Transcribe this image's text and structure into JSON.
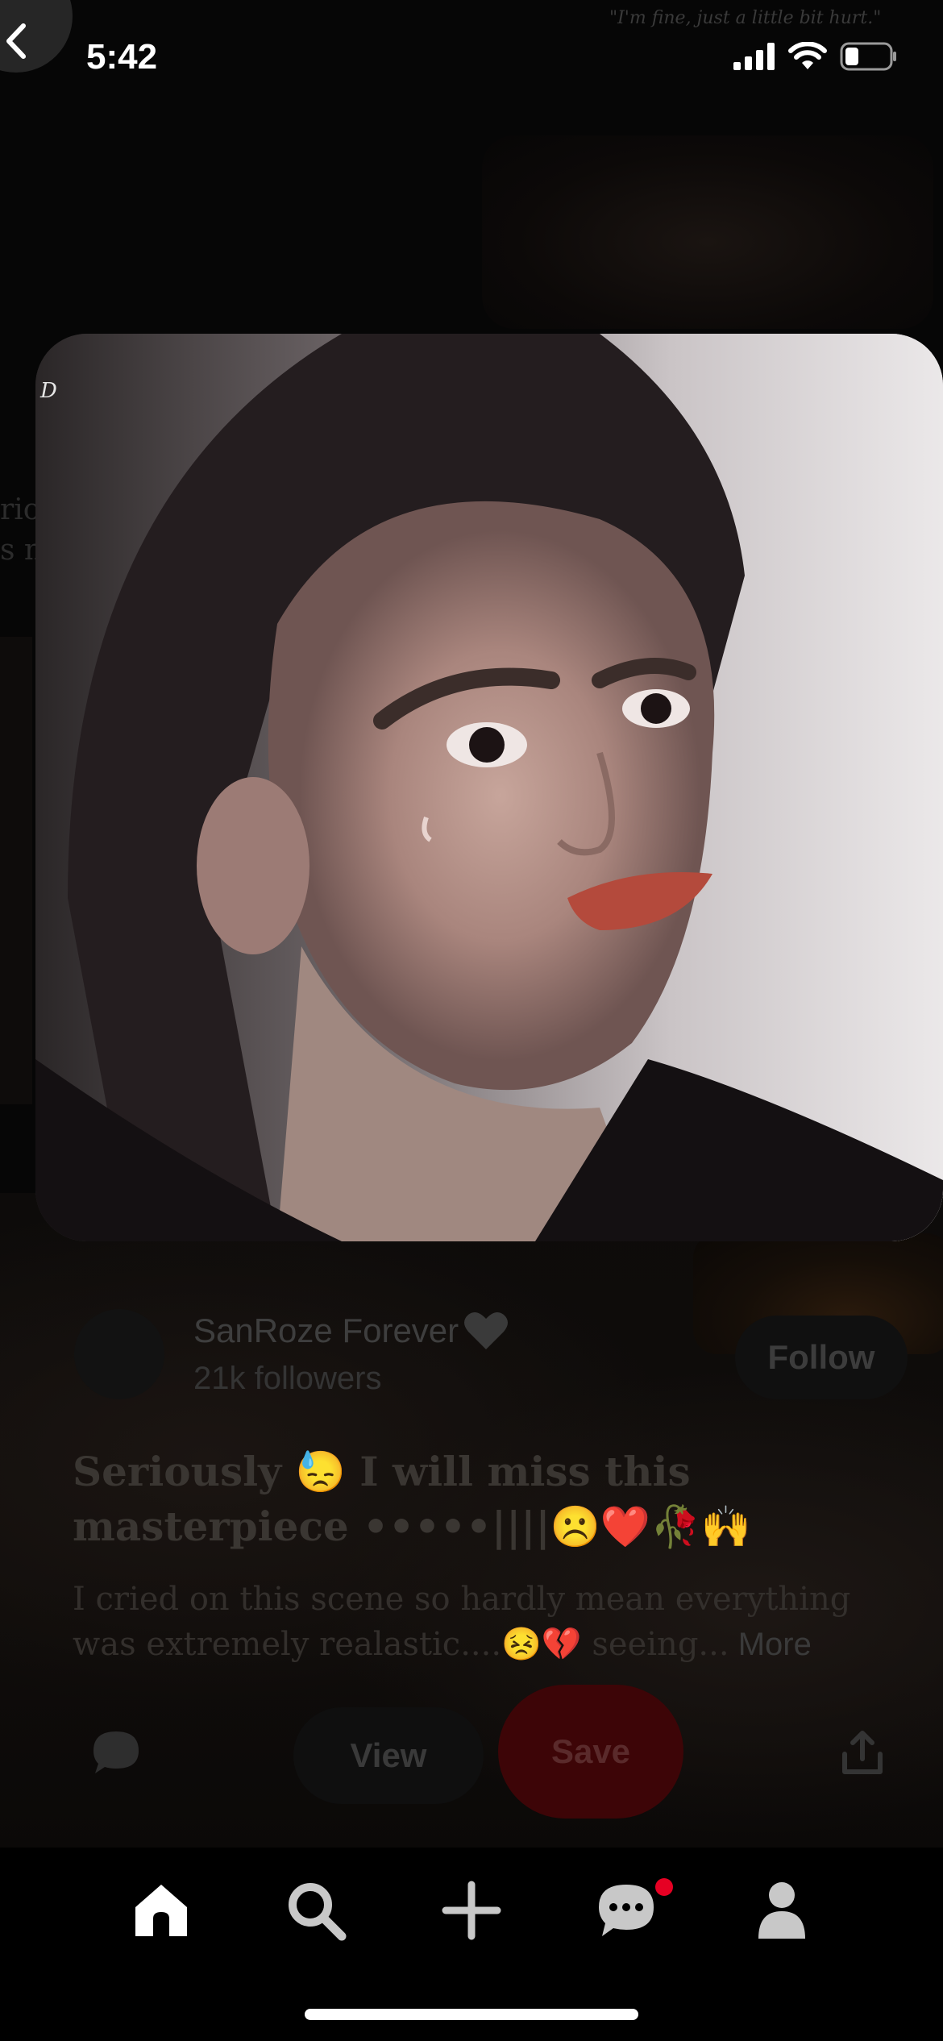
{
  "status_bar": {
    "time": "5:42"
  },
  "background": {
    "quote": "\"I'm fine, just a little bit hurt.\"",
    "fragment_1": "rio",
    "fragment_2": "s n"
  },
  "pin": {
    "watermark": "D",
    "creator": {
      "name": "SanRoze Forever",
      "followers": "21k followers"
    },
    "follow_label": "Follow",
    "title": "Seriously 😓 I will miss this masterpiece •••••||||☹️❤️🥀🙌",
    "description": "I cried on this scene so hardly mean everything was extremely realastic....😣💔  seeing...",
    "more_label": " More",
    "view_label": "View",
    "save_label": "Save"
  },
  "tabs": [
    {
      "name": "home",
      "icon": "home-icon",
      "active": true
    },
    {
      "name": "search",
      "icon": "search-icon",
      "active": false
    },
    {
      "name": "create",
      "icon": "plus-icon",
      "active": false
    },
    {
      "name": "messages",
      "icon": "chat-bubble-icon",
      "active": false,
      "badge": true
    },
    {
      "name": "profile",
      "icon": "person-icon",
      "active": false
    }
  ],
  "colors": {
    "accent": "#e60023",
    "tab_icon": "#c8c8c8",
    "tab_active": "#ffffff"
  }
}
